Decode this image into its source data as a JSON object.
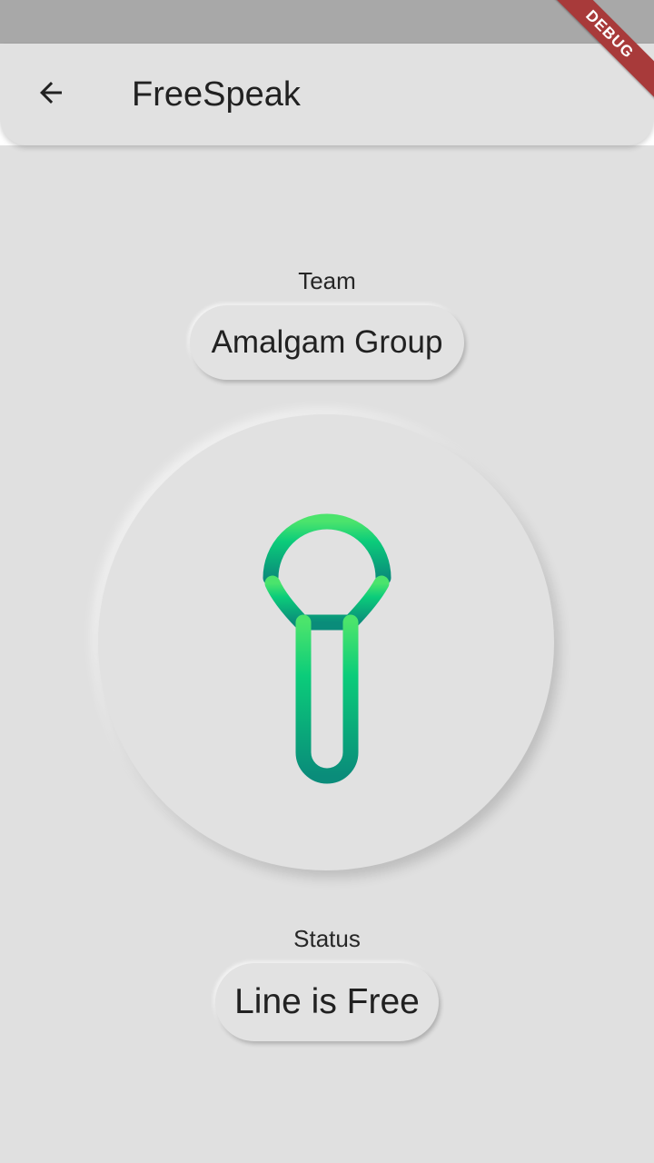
{
  "app_bar": {
    "title": "FreeSpeak",
    "back_icon": "arrow-back-icon"
  },
  "debug_banner": {
    "label": "DEBUG"
  },
  "team": {
    "label": "Team",
    "value": "Amalgam Group"
  },
  "mic": {
    "icon": "microphone-icon",
    "gradient_top": "#4be46c",
    "gradient_bottom": "#0a8c7a"
  },
  "status": {
    "label": "Status",
    "value": "Line is Free"
  },
  "colors": {
    "background": "#e0e0e0",
    "status_bar": "#a8a8a8",
    "debug_banner": "#a83a3a"
  }
}
